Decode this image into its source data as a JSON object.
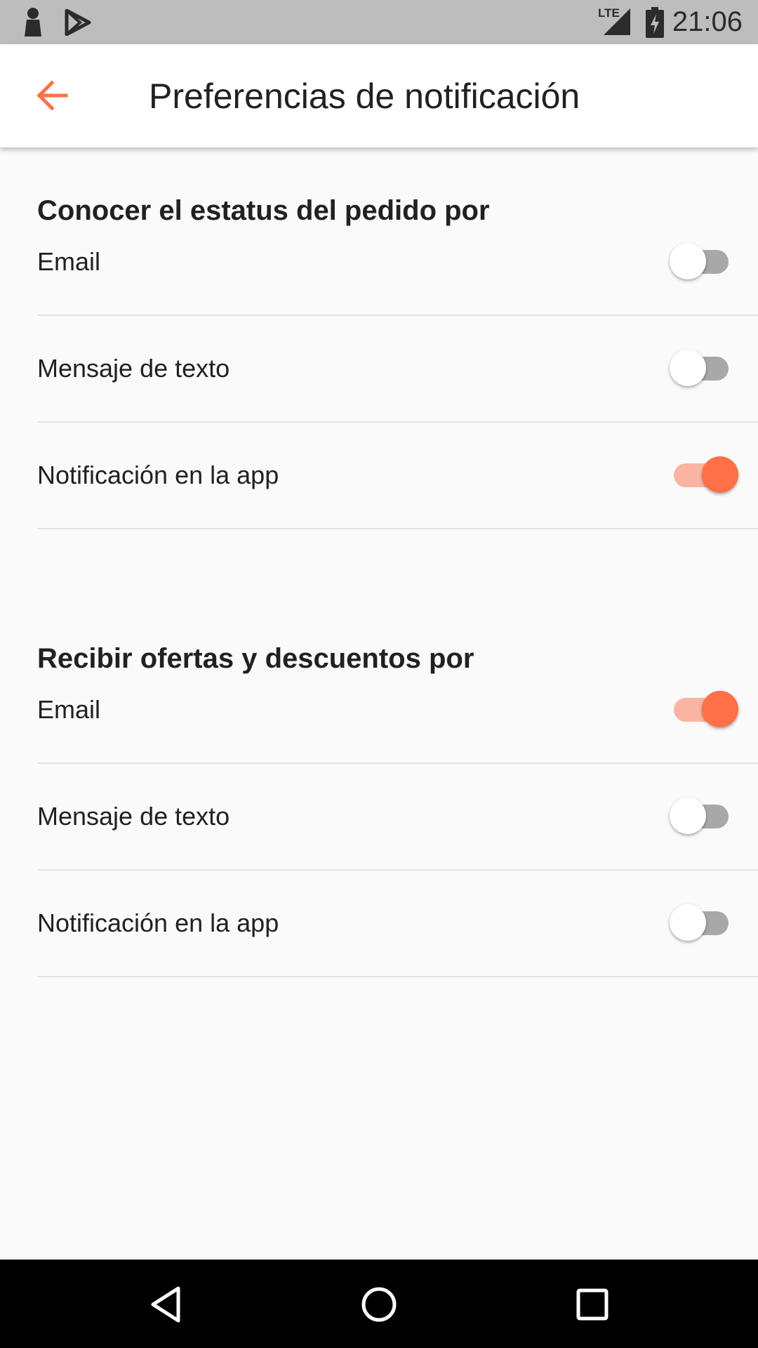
{
  "status_bar": {
    "time": "21:06",
    "icons": [
      "notification-person-icon",
      "play-store-icon",
      "lte-signal-icon",
      "battery-charging-icon"
    ],
    "network_label": "LTE"
  },
  "app_bar": {
    "back_icon": "arrow-left-icon",
    "title": "Preferencias de notificación"
  },
  "sections": [
    {
      "title": "Conocer el estatus del pedido por",
      "items": [
        {
          "label": "Email",
          "enabled": false
        },
        {
          "label": "Mensaje de texto",
          "enabled": false
        },
        {
          "label": "Notificación en la app",
          "enabled": true
        }
      ]
    },
    {
      "title": "Recibir ofertas y descuentos por",
      "items": [
        {
          "label": "Email",
          "enabled": true
        },
        {
          "label": "Mensaje de texto",
          "enabled": false
        },
        {
          "label": "Notificación en la app",
          "enabled": false
        }
      ]
    }
  ],
  "nav_bar": {
    "icons": [
      "back-triangle-icon",
      "home-circle-icon",
      "recents-square-icon"
    ]
  },
  "colors": {
    "accent": "#ff7047",
    "accent_track": "#fcb4a2",
    "switch_off_track": "#a8a8a8",
    "status_bar": "#bdbdbd",
    "background": "#fafafa"
  }
}
